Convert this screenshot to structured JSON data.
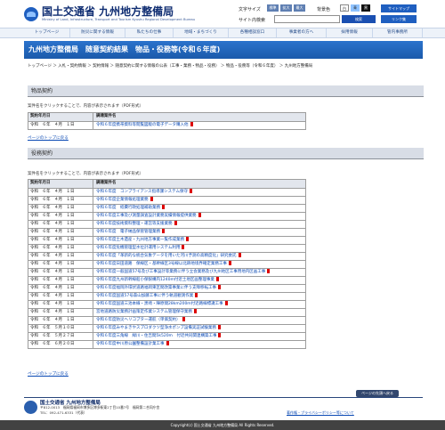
{
  "header": {
    "logo_main": "国土交通省 九州地方整備局",
    "logo_sub": "Ministry of Land, Infrastructure, Transport and Tourism Kyushu Regional Development Bureau"
  },
  "utility": {
    "font_size_label": "文字サイズ",
    "font_small": "標準",
    "font_medium": "拡大",
    "font_large": "最大",
    "background_label": "背景色",
    "bg_white": "白",
    "bg_blue": "青",
    "bg_black": "黒",
    "search_label": "サイト内検索",
    "search_placeholder": "",
    "search_button": "検索",
    "sitemap": "サイトマップ",
    "link_collection": "リンク集"
  },
  "nav": {
    "items": [
      "トップページ",
      "防災に関する情報",
      "私たちの仕事",
      "地域・まちづくり",
      "各種相談窓口",
      "事業者の方へ",
      "採用情報",
      "管内事務所"
    ]
  },
  "page": {
    "banner_title": "九州地方整備局　随意契約結果　物品・役務等(令和６年度)",
    "breadcrumb": "トップページ ＞ 入札・契約情報 ＞ 契約情報 ＞ 随意契約に関する情報の公表（工事・業務・物品・役務） ＞ 物品・役務等（令和６年度） ＞ 九州地方整備局"
  },
  "goods": {
    "section_title": "物品契約",
    "note": "案件名をクリックすることで、内容が表示されます（PDF形式）",
    "table": {
      "header": [
        "契約年月日",
        "調達案件名"
      ],
      "rows": [
        [
          "令和　６年　４月　１日",
          "令和６年度携帯資料等閲覧図版の電子データ購入他"
        ]
      ]
    },
    "back_top": "ページのトップに戻る"
  },
  "services": {
    "section_title": "役務契約",
    "note": "案件名をクリックすることで、内容が表示されます（PDF形式）",
    "table": {
      "header": [
        "契約年月日",
        "調達案件名"
      ],
      "rows": [
        [
          "令和　６年　４月　１日",
          "令和６年度　コンプライアンス指導課システム保守"
        ],
        [
          "令和　６年　４月　１日",
          "令和６年度企業情報処理業務"
        ],
        [
          "令和　６年　４月　１日",
          "令和６年度　経費行政処理補助業務"
        ],
        [
          "令和　６年　４月　１日",
          "令和６年度工事及び測量調査設計業務実績情報提供業務"
        ],
        [
          "令和　６年　４月　１日",
          "令和６年度技術資料整理・運営等支援業務"
        ],
        [
          "令和　６年　４月　１日",
          "令和６年度　電子納品保管管理業務"
        ],
        [
          "令和　６年　４月　１日",
          "令和６年度土木遺産・九州地方事業一覧作成業務"
        ],
        [
          "令和　６年　４月　１日",
          "令和６年度危機管理型水位計運用システム利用"
        ],
        [
          "令和　６年　４月　１日",
          "令和６年度「革新的な統合気象データを用いた河川予測の高精度化」研究委託"
        ],
        [
          "令和　６年　４月　１日",
          "令和６年度日田道路　保線区・基幹線区3号線以北跡地境界確定業務工事"
        ],
        [
          "令和　６年　４月　１日",
          "令和６年度一般国道57号及び工事設計等業務に伴う立会業務及び九州地区工事用地内区画工事"
        ],
        [
          "令和　６年　４月　１日",
          "令和６年度九州新幹線船小保駅構内1240m付近土地区画整理事業"
        ],
        [
          "令和　６年　４月　１日",
          "令和６年度福岡外環状道路福岡東区間改築事業に伴う支障移転工事"
        ],
        [
          "令和　６年　４月　１日",
          "令和６年度国道57号森山加藤工事に伴う軌道観測作業"
        ],
        [
          "令和　６年　４月　１日",
          "令和６年度国道三池本線・黒崎・陣原間28km200m付近路線標識工事"
        ],
        [
          "令和　６年　４月　１日",
          "宮地道路防災業務計画策定作業システム管理保守業務"
        ],
        [
          "令和　６年　４月　１日",
          "令和６年度防災ヘリコプター運航（単価契約）"
        ],
        [
          "令和　６年　５月１０日",
          "令和６年度みやまきやスプロダクツ型浄水ポンプ設備実証試験業務"
        ],
        [
          "令和　６年　５月２７日",
          "令和６年度三角線　緑川・住吉間5k520m　付近共同関連構築工事"
        ],
        [
          "令和　６年　６月２０日",
          "令和６年度中川原公園整備設計業工事"
        ]
      ]
    },
    "back_top": "ページのトップに戻る"
  },
  "footer": {
    "page_top": "ページの先頭へ戻る",
    "org": "国土交通省 九州地方整備局",
    "address": "〒812-0013　福岡県福岡市博多区博多駅東2丁目10番7号　福岡第二合同庁舎",
    "tel": "TEL：092-471-6331（代表）",
    "links": "著作権・プライバシーポリシー等について",
    "copyright": "Copyright(c) 国土交通省 九州地方整備局 All Rights Reserved."
  }
}
